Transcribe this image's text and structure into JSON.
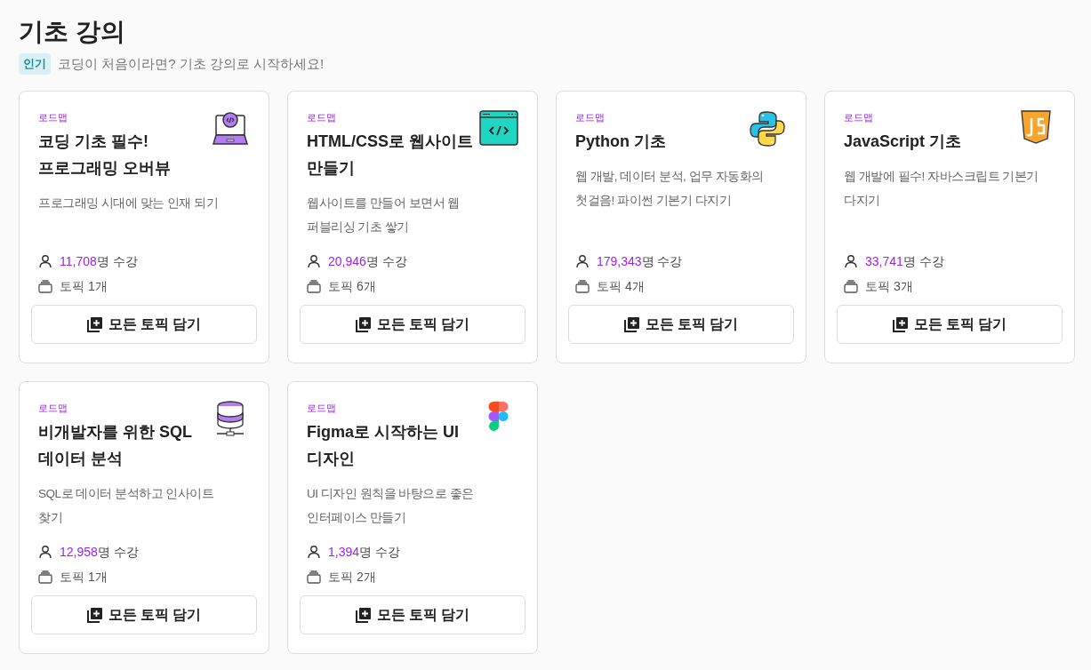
{
  "heading": "기초 강의",
  "badge": "인기",
  "subtitle": "코딩이 처음이라면? 기초 강의로 시작하세요!",
  "cards": [
    {
      "kind": "laptop",
      "label": "로드맵",
      "title": [
        "코딩 기초 필수!",
        "프로그래밍 오버뷰"
      ],
      "description": [
        "프로그래밍 시대에 맞는 인재 되기"
      ],
      "students": "11,708",
      "students_suffix": "명 수강",
      "topics": "토픽 1개",
      "button": "모든 토픽 담기"
    },
    {
      "kind": "window",
      "label": "로드맵",
      "title": [
        "HTML/CSS로 웹사이트",
        "만들기"
      ],
      "description": [
        "웹사이트를 만들어 보면서 웹",
        "퍼블리싱 기초 쌓기"
      ],
      "students": "20,946",
      "students_suffix": "명 수강",
      "topics": "토픽 6개",
      "button": "모든 토픽 담기"
    },
    {
      "kind": "snakes",
      "label": "로드맵",
      "title": [
        "Python 기초"
      ],
      "description": [
        "웹 개발, 데이터 분석, 업무 자동화의",
        "첫걸음! 파이썬 기본기 다지기"
      ],
      "students": "179,343",
      "students_suffix": "명 수강",
      "topics": "토픽 4개",
      "button": "모든 토픽 담기"
    },
    {
      "kind": "shield",
      "label": "로드맵",
      "title": [
        "JavaScript 기초"
      ],
      "description": [
        "웹 개발에 필수! 자바스크립트 기본기",
        "다지기"
      ],
      "students": "33,741",
      "students_suffix": "명 수강",
      "topics": "토픽 3개",
      "button": "모든 토픽 담기"
    },
    {
      "kind": "database",
      "label": "로드맵",
      "title": [
        "비개발자를 위한 SQL",
        "데이터 분석"
      ],
      "description": [
        "SQL로 데이터 분석하고 인사이트",
        "찾기"
      ],
      "students": "12,958",
      "students_suffix": "명 수강",
      "topics": "토픽 1개",
      "button": "모든 토픽 담기"
    },
    {
      "kind": "shapes",
      "label": "로드맵",
      "title": [
        "Figma로 시작하는 UI",
        "디자인"
      ],
      "description": [
        "UI 디자인 원칙을 바탕으로 좋은",
        "인터페이스 만들기"
      ],
      "students": "1,394",
      "students_suffix": "명 수강",
      "topics": "토픽 2개",
      "button": "모든 토픽 담기"
    }
  ]
}
